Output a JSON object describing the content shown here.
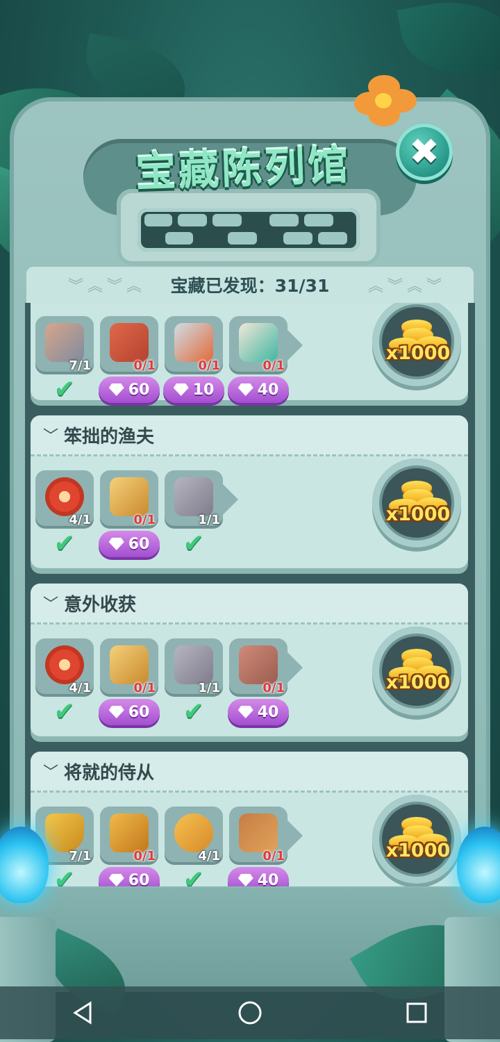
{
  "header": {
    "title": "宝藏陈列馆",
    "close_label": "✖",
    "discover_label": "宝藏已发现：31/31"
  },
  "colors": {
    "accent_teal": "#229183",
    "gem_purple": "#a24fd0",
    "check_green": "#3fc97d",
    "coin_gold": "#ffe25a"
  },
  "collections": [
    {
      "name": "",
      "reward": "x1000",
      "items": [
        {
          "icon": "hammer-icon",
          "count": "7/1",
          "owned": true,
          "price": ""
        },
        {
          "icon": "bone-icon",
          "count": "0/1",
          "owned": false,
          "price": "60"
        },
        {
          "icon": "spear-icon",
          "count": "0/1",
          "owned": false,
          "price": "10"
        },
        {
          "icon": "skull-necklace-icon",
          "count": "0/1",
          "owned": false,
          "price": "40"
        }
      ]
    },
    {
      "name": "笨拙的渔夫",
      "reward": "x1000",
      "items": [
        {
          "icon": "target-icon",
          "count": "4/1",
          "owned": true,
          "price": ""
        },
        {
          "icon": "bow-icon",
          "count": "0/1",
          "owned": false,
          "price": "60"
        },
        {
          "icon": "snake-stone-icon",
          "count": "1/1",
          "owned": true,
          "price": ""
        }
      ]
    },
    {
      "name": "意外收获",
      "reward": "x1000",
      "items": [
        {
          "icon": "target-icon",
          "count": "4/1",
          "owned": true,
          "price": ""
        },
        {
          "icon": "bow-icon",
          "count": "0/1",
          "owned": false,
          "price": "60"
        },
        {
          "icon": "snake-stone-icon",
          "count": "1/1",
          "owned": true,
          "price": ""
        },
        {
          "icon": "spider-stone-icon",
          "count": "0/1",
          "owned": false,
          "price": "40"
        }
      ]
    },
    {
      "name": "将就的侍从",
      "reward": "x1000",
      "items": [
        {
          "icon": "shield-icon",
          "count": "7/1",
          "owned": true,
          "price": ""
        },
        {
          "icon": "armor-icon",
          "count": "0/1",
          "owned": false,
          "price": "60"
        },
        {
          "icon": "belt-icon",
          "count": "4/1",
          "owned": true,
          "price": ""
        },
        {
          "icon": "slingshot-icon",
          "count": "0/1",
          "owned": false,
          "price": "40"
        }
      ]
    }
  ],
  "nav": {
    "back": "back-icon",
    "home": "home-icon",
    "recents": "recents-icon"
  }
}
